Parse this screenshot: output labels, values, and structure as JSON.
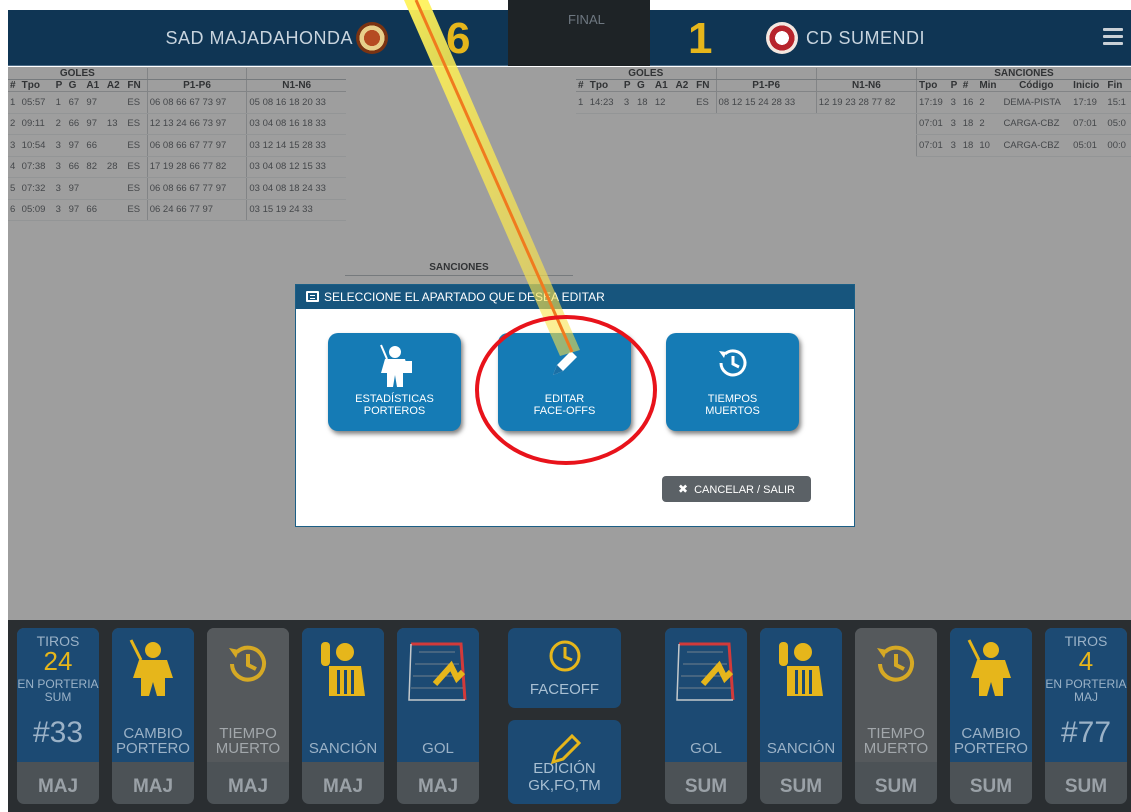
{
  "scoreboard": {
    "home_team": "SAD MAJADAHONDA",
    "home_score": "6",
    "period": "FINAL",
    "away_score": "1",
    "away_team": "CD SUMENDI"
  },
  "home_goals": {
    "group_label": "GOLES",
    "group_label_players": "P1-P6",
    "group_label_opp": "N1-N6",
    "headers": [
      "#",
      "Tpo",
      "P",
      "G",
      "A1",
      "A2",
      "FN"
    ],
    "rows": [
      {
        "n": "1",
        "tpo": "05:57",
        "p": "1",
        "g": "67",
        "a1": "97",
        "a2": "",
        "fn": "ES",
        "p16": "06 08 66 67 73 97",
        "n16": "05 08 16 18 20 33"
      },
      {
        "n": "2",
        "tpo": "09:11",
        "p": "2",
        "g": "66",
        "a1": "97",
        "a2": "13",
        "fn": "ES",
        "p16": "12 13 24 66 73 97",
        "n16": "03 04 08 16 18 33"
      },
      {
        "n": "3",
        "tpo": "10:54",
        "p": "3",
        "g": "97",
        "a1": "66",
        "a2": "",
        "fn": "ES",
        "p16": "06 08 66 67 77 97",
        "n16": "03 12 14 15 28 33"
      },
      {
        "n": "4",
        "tpo": "07:38",
        "p": "3",
        "g": "66",
        "a1": "82",
        "a2": "28",
        "fn": "ES",
        "p16": "17 19 28 66 77 82",
        "n16": "03 04 08 12 15 33"
      },
      {
        "n": "5",
        "tpo": "07:32",
        "p": "3",
        "g": "97",
        "a1": "",
        "a2": "",
        "fn": "ES",
        "p16": "06 08 66 67 77 97",
        "n16": "03 04 08 18 24 33"
      },
      {
        "n": "6",
        "tpo": "05:09",
        "p": "3",
        "g": "97",
        "a1": "66",
        "a2": "",
        "fn": "ES",
        "p16": "06 24 66 77 97",
        "n16": "03 15 19 24 33"
      }
    ]
  },
  "home_sanctions_label": "SANCIONES",
  "away_goals": {
    "group_label": "GOLES",
    "group_label_players": "P1-P6",
    "group_label_opp": "N1-N6",
    "headers": [
      "#",
      "Tpo",
      "P",
      "G",
      "A1",
      "A2",
      "FN"
    ],
    "rows": [
      {
        "n": "1",
        "tpo": "14:23",
        "p": "3",
        "g": "18",
        "a1": "12",
        "a2": "",
        "fn": "ES",
        "p16": "08 12 15 24 28 33",
        "n16": "12 19 23 28 77 82"
      }
    ]
  },
  "away_sanctions": {
    "group_label": "SANCIONES",
    "headers": [
      "Tpo",
      "P",
      "#",
      "Min",
      "Código",
      "Inicio",
      "Fin"
    ],
    "rows": [
      {
        "tpo": "17:19",
        "p": "3",
        "num": "16",
        "min": "2",
        "code": "DEMA-PISTA",
        "start": "17:19",
        "end": "15:1"
      },
      {
        "tpo": "07:01",
        "p": "3",
        "num": "18",
        "min": "2",
        "code": "CARGA-CBZ",
        "start": "07:01",
        "end": "05:0"
      },
      {
        "tpo": "07:01",
        "p": "3",
        "num": "18",
        "min": "10",
        "code": "CARGA-CBZ",
        "start": "05:01",
        "end": "00:0"
      }
    ]
  },
  "modal": {
    "title": "SELECCIONE EL APARTADO QUE DESEA EDITAR",
    "options": [
      {
        "line1": "ESTADÍSTICAS",
        "line2": "PORTEROS",
        "icon": "goalie-icon"
      },
      {
        "line1": "EDITAR",
        "line2": "FACE-OFFS",
        "icon": "pencil-icon"
      },
      {
        "line1": "TIEMPOS",
        "line2": "MUERTOS",
        "icon": "history-clock-icon"
      }
    ],
    "cancel_label": "CANCELAR / SALIR"
  },
  "toolbar": {
    "left": {
      "shots": {
        "top": "TIROS",
        "count": "24",
        "sub1": "EN PORTERIA",
        "sub2": "SUM",
        "jersey": "#33",
        "team": "MAJ"
      },
      "goalie_change": {
        "line1": "CAMBIO",
        "line2": "PORTERO",
        "team": "MAJ"
      },
      "timeout": {
        "line1": "TIEMPO",
        "line2": "MUERTO",
        "team": "MAJ"
      },
      "penalty": {
        "label": "SANCIÓN",
        "team": "MAJ"
      },
      "goal": {
        "label": "GOL",
        "team": "MAJ"
      }
    },
    "center": {
      "faceoff": "FACEOFF",
      "edit": "EDICIÓN GK,FO,TM"
    },
    "right": {
      "goal": {
        "label": "GOL",
        "team": "SUM"
      },
      "penalty": {
        "label": "SANCIÓN",
        "team": "SUM"
      },
      "timeout": {
        "line1": "TIEMPO",
        "line2": "MUERTO",
        "team": "SUM"
      },
      "goalie_change": {
        "line1": "CAMBIO",
        "line2": "PORTERO",
        "team": "SUM"
      },
      "shots": {
        "top": "TIROS",
        "count": "4",
        "sub1": "EN PORTERIA",
        "sub2": "MAJ",
        "jersey": "#77",
        "team": "SUM"
      }
    }
  },
  "colors": {
    "header_bg": "#0f3554",
    "score": "#e6b61b",
    "modal_button": "#157bb5",
    "annotation_circle": "#e8131b",
    "annotation_arrow": "#f07a1e"
  }
}
